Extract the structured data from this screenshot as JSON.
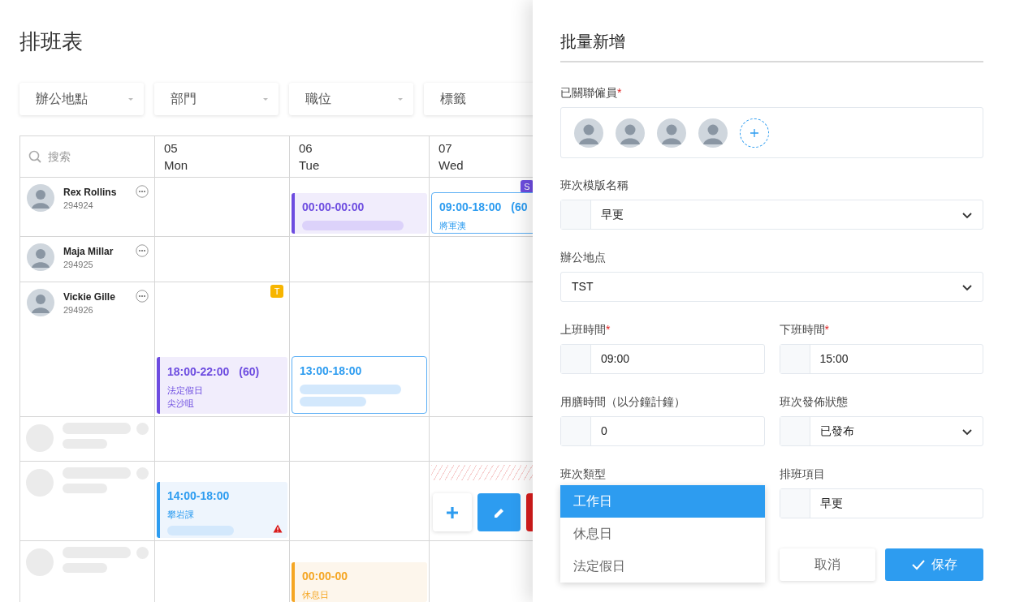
{
  "page": {
    "title": "排班表",
    "filters": [
      {
        "label": "辦公地點"
      },
      {
        "label": "部門"
      },
      {
        "label": "職位"
      },
      {
        "label": "標籤"
      }
    ],
    "search": {
      "placeholder": "搜索"
    },
    "days": [
      {
        "date": "05",
        "weekday": "Mon"
      },
      {
        "date": "06",
        "weekday": "Tue"
      },
      {
        "date": "07",
        "weekday": "Wed"
      }
    ],
    "rows": [
      {
        "kind": "employee",
        "name": "Rex Rollins",
        "id": "294924",
        "cells": [
          {},
          {
            "shift": {
              "kind": "holiday",
              "time": "00:00-00:00",
              "masked": [
                {
                  "kind": "long"
                }
              ]
            }
          },
          {
            "badge": {
              "text": "S",
              "color": "#6d4ce0"
            },
            "shift": {
              "kind": "outline",
              "time": "09:00-18:00",
              "break": "(60",
              "notes": [
                "將軍澳"
              ]
            }
          }
        ]
      },
      {
        "kind": "employee",
        "name": "Maja Millar",
        "id": "294925",
        "cells": [
          {},
          {},
          {}
        ]
      },
      {
        "kind": "employee",
        "name": "Vickie Gille",
        "id": "294926",
        "cells": [
          {
            "badge": {
              "text": "T",
              "color": "#f7b500"
            },
            "shift": {
              "kind": "holiday",
              "time": "18:00-22:00",
              "break": "(60)",
              "notes": [
                "法定假日",
                "尖沙咀"
              ]
            }
          },
          {
            "shift": {
              "kind": "outline",
              "time": "13:00-18:00",
              "masked": [
                {
                  "kind": "long"
                },
                {
                  "kind": "short"
                }
              ]
            }
          },
          {}
        ]
      },
      {
        "kind": "loading",
        "cells": [
          {},
          {},
          {}
        ]
      },
      {
        "kind": "loading",
        "cells": [
          {
            "shift": {
              "kind": "regular",
              "time": "14:00-18:00",
              "notes": [
                "攀岩課"
              ],
              "masked": [
                {
                  "kind": "short"
                }
              ],
              "warning": true
            }
          },
          {},
          {
            "hatched": true,
            "actions": [
              {
                "kind": "add"
              },
              {
                "kind": "edit"
              },
              {
                "kind": "delete"
              }
            ]
          }
        ]
      },
      {
        "kind": "loading",
        "cells": [
          {},
          {
            "shift": {
              "kind": "rest",
              "time": "00:00-00",
              "notes": [
                "休息日"
              ]
            }
          },
          {}
        ]
      }
    ]
  },
  "drawer": {
    "title": "批量新增",
    "employees": {
      "label": "已關聯僱員",
      "required_mark": "*",
      "items": [
        {
          "kind": "avatar"
        },
        {
          "kind": "avatar"
        },
        {
          "kind": "avatar"
        },
        {
          "kind": "avatar"
        },
        {
          "kind": "add"
        }
      ]
    },
    "field_rows": [
      [
        {
          "kind": "select",
          "label": "班次模版名稱",
          "prefix": true,
          "value": "早更"
        }
      ],
      [
        {
          "kind": "select",
          "label": "辦公地点",
          "prefix": false,
          "value": "TST"
        }
      ],
      [
        {
          "kind": "input",
          "label": "上班時間",
          "required_mark": "*",
          "prefix": true,
          "value": "09:00"
        },
        {
          "kind": "input",
          "label": "下班時間",
          "required_mark": "*",
          "prefix": true,
          "value": "15:00"
        }
      ],
      [
        {
          "kind": "input",
          "label": "用膳時間（以分鐘計鐘）",
          "prefix": true,
          "value": "0"
        },
        {
          "kind": "select",
          "label": "班次發佈狀態",
          "prefix": true,
          "value": "已發布"
        }
      ],
      [
        {
          "kind": "dropdown",
          "label": "班次類型",
          "options": [
            {
              "label": "工作日",
              "selected": true
            },
            {
              "label": "休息日",
              "selected": false
            },
            {
              "label": "法定假日",
              "selected": false
            }
          ]
        },
        {
          "kind": "input",
          "label": "排班項目",
          "prefix": true,
          "value": "早更"
        }
      ]
    ],
    "buttons": [
      {
        "kind": "secondary",
        "label": "取消"
      },
      {
        "kind": "primary",
        "label": "保存"
      }
    ]
  }
}
